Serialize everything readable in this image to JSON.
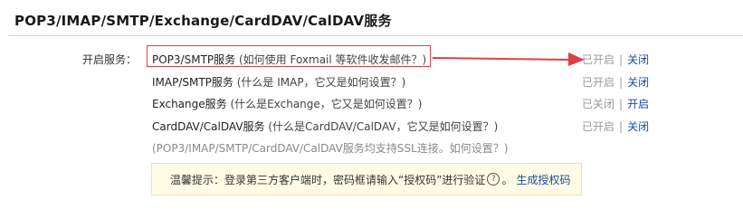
{
  "header": {
    "title": "POP3/IMAP/SMTP/Exchange/CardDAV/CalDAV服务"
  },
  "label": "开启服务：",
  "services": [
    {
      "name": "POP3/SMTP服务",
      "hint": "(如何使用 Foxmail 等软件收发邮件？)",
      "status": "已开启",
      "action": "关闭"
    },
    {
      "name": "IMAP/SMTP服务",
      "hint": "(什么是 IMAP，它又是如何设置？)",
      "status": "已开启",
      "action": "关闭"
    },
    {
      "name": "Exchange服务",
      "hint": "(什么是Exchange，它又是如何设置？)",
      "status": "已关闭",
      "action": "开启"
    },
    {
      "name": "CardDAV/CalDAV服务",
      "hint": "(什么是CardDAV/CalDAV，它又是如何设置？)",
      "status": "已开启",
      "action": "关闭"
    }
  ],
  "ssl_note": "(POP3/IMAP/SMTP/CardDAV/CalDAV服务均支持SSL连接。如何设置？)",
  "tip": {
    "text": "温馨提示：登录第三方客户端时，密码框请输入“授权码”进行验证",
    "link": "生成授权码"
  },
  "colors": {
    "accent": "#1a4e9a",
    "highlight": "#e04040",
    "tip_bg": "#fffbe6"
  }
}
